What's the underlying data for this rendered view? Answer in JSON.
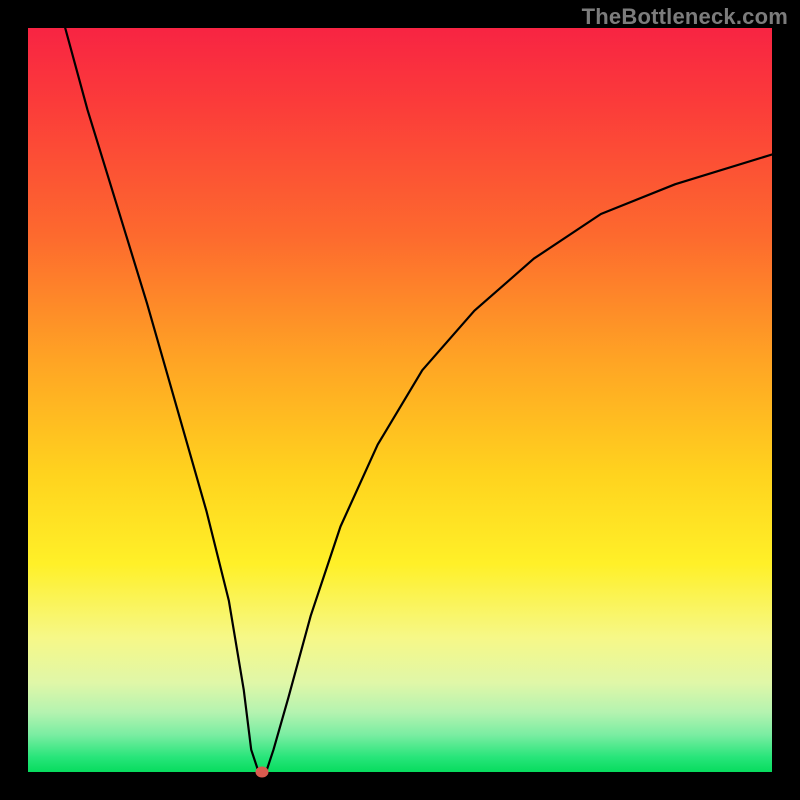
{
  "watermark": "TheBottleneck.com",
  "chart_data": {
    "type": "line",
    "title": "",
    "xlabel": "",
    "ylabel": "",
    "xlim": [
      0,
      100
    ],
    "ylim": [
      0,
      100
    ],
    "grid": false,
    "legend": false,
    "series": [
      {
        "name": "bottleneck-curve",
        "x": [
          5,
          8,
          12,
          16,
          20,
          24,
          27,
          29,
          30,
          31,
          32,
          33,
          35,
          38,
          42,
          47,
          53,
          60,
          68,
          77,
          87,
          100
        ],
        "values": [
          100,
          89,
          76,
          63,
          49,
          35,
          23,
          11,
          3,
          0,
          0,
          3,
          10,
          21,
          33,
          44,
          54,
          62,
          69,
          75,
          79,
          83
        ]
      }
    ],
    "marker": {
      "x": 31.5,
      "y": 0,
      "color": "#d85b4f"
    },
    "background_gradient": {
      "top": "#f82443",
      "mid": "#ffd31e",
      "bottom": "#07dc5e"
    }
  }
}
